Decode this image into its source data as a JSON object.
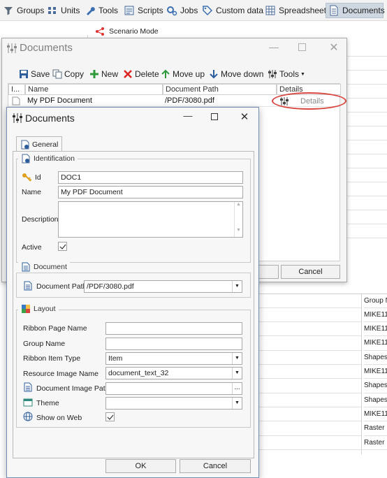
{
  "toolbar": {
    "items": [
      {
        "label": "Groups",
        "icon": "filter-icon"
      },
      {
        "label": "Units",
        "icon": "units-icon"
      },
      {
        "label": "Tools",
        "icon": "wrench-icon"
      },
      {
        "label": "Scripts",
        "icon": "scripts-icon"
      },
      {
        "label": "Jobs",
        "icon": "gears-icon"
      },
      {
        "label": "Custom data",
        "icon": "tag-icon"
      },
      {
        "label": "Spreadsheets",
        "icon": "spreadsheet-icon"
      },
      {
        "label": "Documents",
        "icon": "document-icon"
      }
    ],
    "active": "Documents"
  },
  "background": {
    "scenario_mode": "Scenario Mode",
    "column_header": "Group N",
    "rows": [
      "MIKE11",
      "MIKE11",
      "MIKE11",
      "Shapes",
      "MIKE11",
      "Shapes",
      "Shapes",
      "MIKE11",
      "Raster",
      "Raster"
    ]
  },
  "outer_window": {
    "title": "Documents",
    "toolbar": {
      "save": "Save",
      "copy": "Copy",
      "new": "New",
      "delete": "Delete",
      "move_up": "Move up",
      "move_down": "Move down",
      "tools": "Tools"
    },
    "grid": {
      "columns": [
        "I...",
        "Name",
        "Document Path",
        "Details"
      ],
      "rows": [
        {
          "name": "My PDF Document",
          "path": "/PDF/3080.pdf",
          "details": "Details"
        }
      ]
    },
    "cancel": "Cancel"
  },
  "inner_window": {
    "title": "Documents",
    "tab": "General",
    "identification": {
      "title": "Identification",
      "id_label": "Id",
      "id_value": "DOC1",
      "name_label": "Name",
      "name_value": "My PDF Document",
      "description_label": "Description",
      "description_value": "",
      "active_label": "Active",
      "active_checked": true
    },
    "document": {
      "title": "Document",
      "path_label": "Document Path",
      "path_value": "/PDF/3080.pdf"
    },
    "layout": {
      "title": "Layout",
      "ribbon_page_label": "Ribbon Page Name",
      "ribbon_page_value": "",
      "group_label": "Group Name",
      "group_value": "",
      "item_type_label": "Ribbon Item Type",
      "item_type_value": "Item",
      "resource_image_label": "Resource Image Name",
      "resource_image_value": "document_text_32",
      "doc_image_label": "Document Image Path",
      "doc_image_value": "",
      "browse": "...",
      "theme_label": "Theme",
      "theme_value": "",
      "show_web_label": "Show on Web",
      "show_web_checked": true
    },
    "ok": "OK",
    "cancel": "Cancel"
  }
}
